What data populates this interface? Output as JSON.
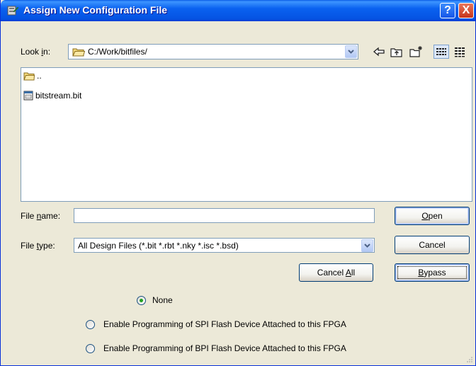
{
  "window": {
    "title": "Assign New Configuration File",
    "help_glyph": "?",
    "close_glyph": "X"
  },
  "lookin": {
    "label_prefix": "Look ",
    "label_accel": "i",
    "label_suffix": "n:",
    "path": "C:/Work/bitfiles/"
  },
  "toolbar": {
    "icons": [
      "back-arrow-icon",
      "up-folder-icon",
      "new-folder-icon",
      "list-view-icon",
      "details-view-icon"
    ]
  },
  "files": [
    {
      "name": "..",
      "icon": "folder-icon"
    },
    {
      "name": "bitstream.bit",
      "icon": "bit-file-icon"
    }
  ],
  "filename": {
    "label_prefix": "File ",
    "label_accel": "n",
    "label_suffix": "ame:",
    "value": ""
  },
  "filetype": {
    "label_prefix": "File ",
    "label_accel": "t",
    "label_suffix": "ype:",
    "value": "All Design Files (*.bit *.rbt *.nky *.isc *.bsd)"
  },
  "buttons": {
    "open_accel": "O",
    "open_rest": "pen",
    "cancel": "Cancel",
    "cancel_all_prefix": "Cancel ",
    "cancel_all_accel": "A",
    "cancel_all_suffix": "ll",
    "bypass_accel": "B",
    "bypass_rest": "ypass"
  },
  "options": {
    "none": "None",
    "spi": "Enable Programming of SPI Flash Device Attached to this FPGA",
    "bpi": "Enable Programming of BPI Flash Device Attached to this FPGA",
    "selected": "none"
  },
  "colors": {
    "title_bar": "#0a5ee7",
    "dialog_bg": "#ece9d8",
    "field_border": "#7f9db9",
    "button_border": "#003c74"
  }
}
